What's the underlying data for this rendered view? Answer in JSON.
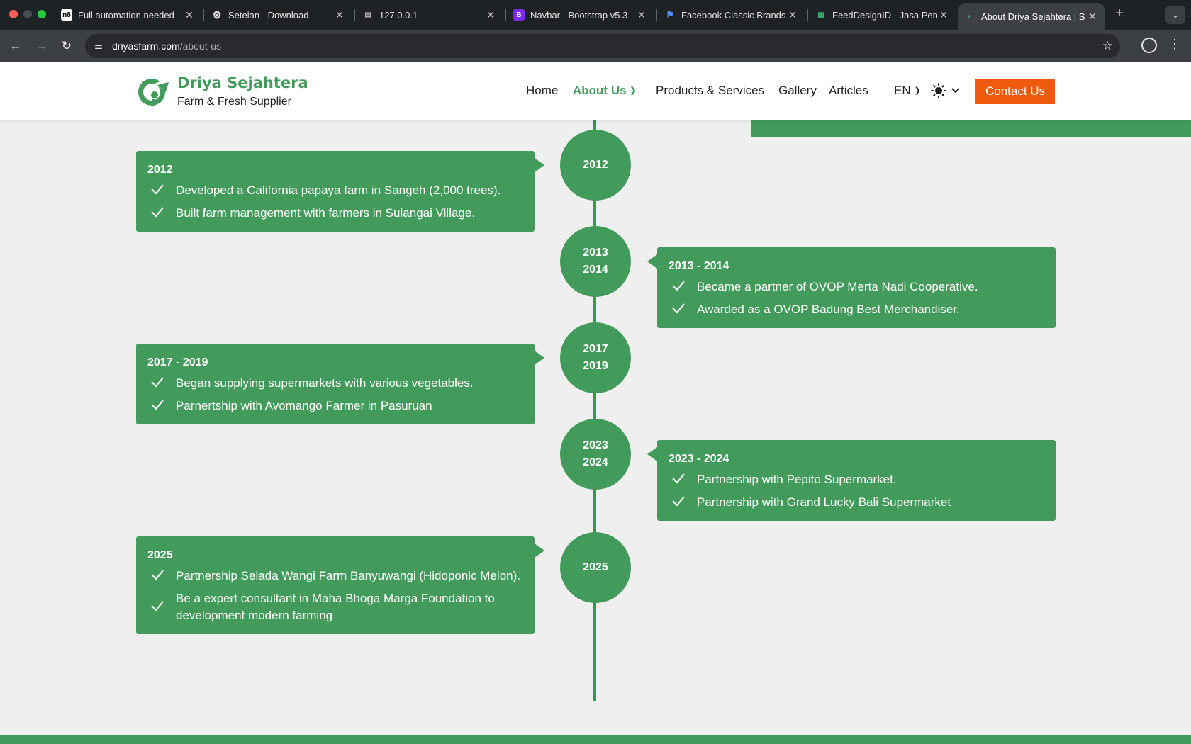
{
  "browser": {
    "tabs": [
      {
        "title": "Full automation needed -",
        "active": false
      },
      {
        "title": "Setelan - Download",
        "active": false
      },
      {
        "title": "127.0.0.1",
        "active": false
      },
      {
        "title": "Navbar · Bootstrap v5.3",
        "active": false
      },
      {
        "title": "Facebook Classic Brands",
        "active": false
      },
      {
        "title": "FeedDesignID - Jasa Pen",
        "active": false
      },
      {
        "title": "About Driya Sejahtera | S",
        "active": true
      }
    ],
    "url_host": "driyasfarm.com",
    "url_path": "/about-us"
  },
  "site": {
    "brand_name": "Driya Sejahtera",
    "brand_tagline": "Farm & Fresh Supplier",
    "nav": {
      "home": "Home",
      "about": "About Us",
      "products": "Products & Services",
      "gallery": "Gallery",
      "articles": "Articles",
      "language": "EN",
      "contact": "Contact Us"
    },
    "colors": {
      "primary_green": "#439b5b",
      "accent_orange": "#f05a0c"
    }
  },
  "timeline": [
    {
      "circle_lines": [
        "2012"
      ],
      "title": "2012",
      "side": "left",
      "items": [
        "Developed a California papaya farm in Sangeh (2,000 trees).",
        "Built farm management with farmers in Sulangai Village."
      ]
    },
    {
      "circle_lines": [
        "2013",
        "2014"
      ],
      "title": "2013 - 2014",
      "side": "right",
      "items": [
        "Became a partner of OVOP Merta Nadi Cooperative.",
        "Awarded as a OVOP Badung Best Merchandiser."
      ]
    },
    {
      "circle_lines": [
        "2017",
        "2019"
      ],
      "title": "2017 - 2019",
      "side": "left",
      "items": [
        "Began supplying supermarkets with various vegetables.",
        "Parnertship with Avomango Farmer in Pasuruan"
      ]
    },
    {
      "circle_lines": [
        "2023",
        "2024"
      ],
      "title": "2023 - 2024",
      "side": "right",
      "items": [
        "Partnership with Pepito Supermarket.",
        "Partnership with Grand Lucky Bali Supermarket"
      ]
    },
    {
      "circle_lines": [
        "2025"
      ],
      "title": "2025",
      "side": "left",
      "items": [
        "Partnership Selada Wangi Farm Banyuwangi (Hidoponic Melon).",
        "Be a expert consultant in Maha Bhoga Marga Foundation to development modern farming"
      ]
    }
  ]
}
